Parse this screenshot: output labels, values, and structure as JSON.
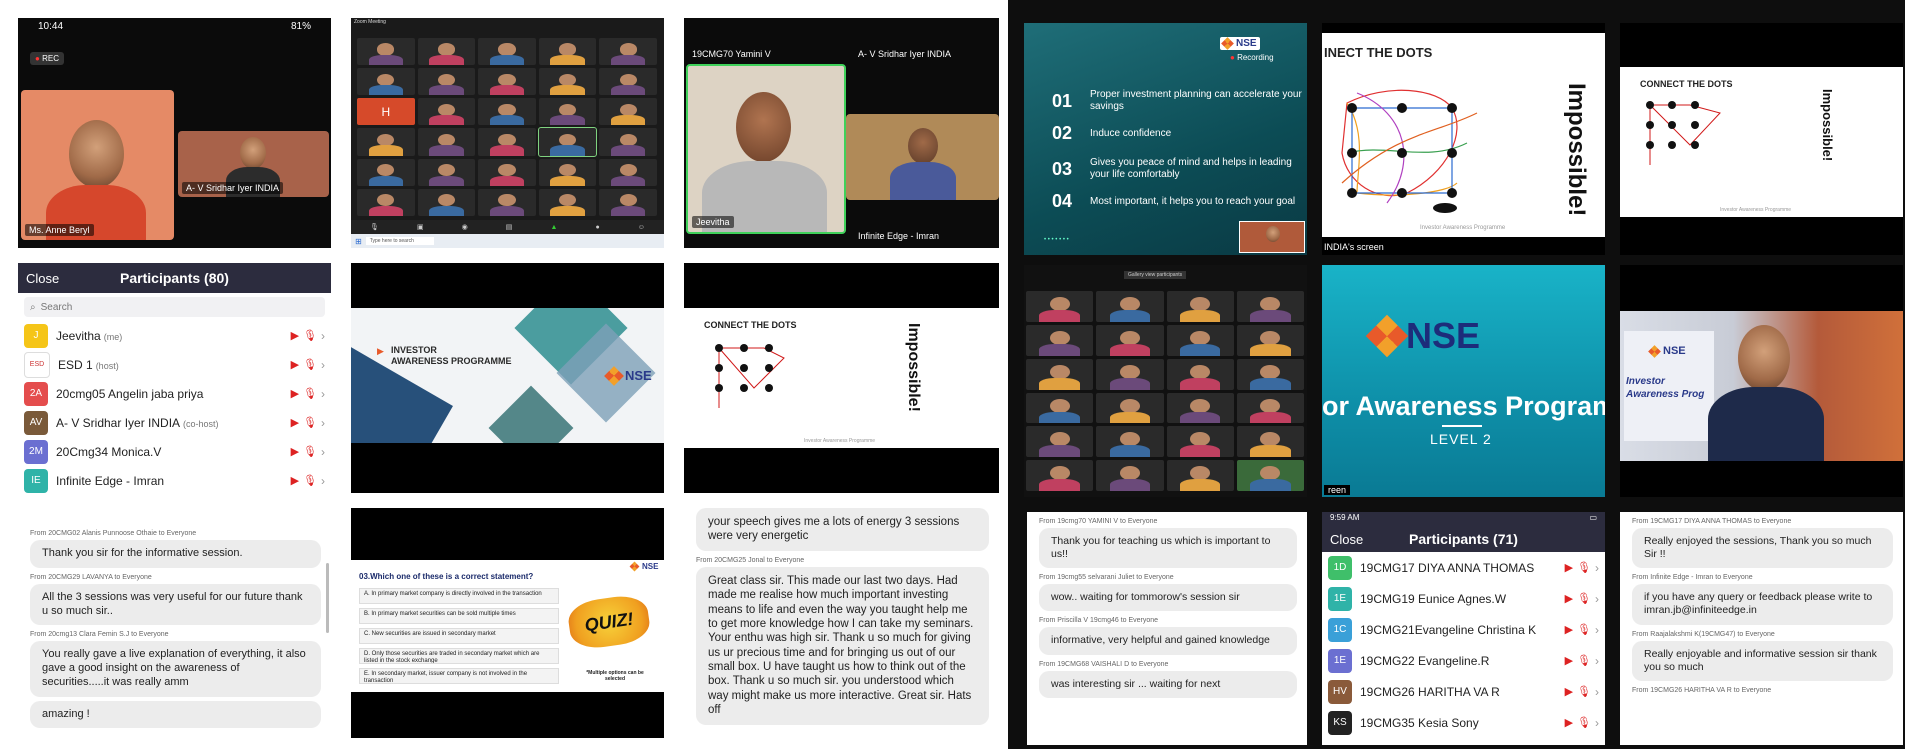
{
  "tile_call": {
    "status_time": "10:44",
    "status_battery": "81%",
    "rec_label": "REC",
    "host_name": "Ms. Anne Beryl",
    "remote_name": "A- V Sridhar Iyer INDIA"
  },
  "tile_zoom_grid": {
    "window_title": "Zoom Meeting",
    "search_placeholder": "Type here to search",
    "h_initial": "H"
  },
  "tile_two": {
    "left_name": "19CMG70 Yamini V",
    "right_name": "A- V Sridhar Iyer INDIA",
    "left_caption": "Jeevitha",
    "right_caption": "Infinite Edge - Imran"
  },
  "participants_left": {
    "close": "Close",
    "title": "Participants (80)",
    "search": "Search",
    "rows": [
      {
        "initials": "J",
        "name": "Jeevitha",
        "tag": "(me)",
        "color": "#f5c518"
      },
      {
        "initials": "ESD",
        "name": "ESD 1",
        "tag": "(host)",
        "color": "#ffffff"
      },
      {
        "initials": "2A",
        "name": "20cmg05 Angelin jaba priya",
        "tag": "",
        "color": "#e44d4d"
      },
      {
        "initials": "AV",
        "name": "A- V Sridhar Iyer INDIA",
        "tag": "(co-host)",
        "color": "#7a5a3a"
      },
      {
        "initials": "2M",
        "name": "20Cmg34 Monica.V",
        "tag": "",
        "color": "#6b6fd1"
      },
      {
        "initials": "IE",
        "name": "Infinite Edge - Imran",
        "tag": "",
        "color": "#2fb3a8"
      }
    ]
  },
  "slide_iap": {
    "title_line1": "INVESTOR",
    "title_line2": "AWARENESS PROGRAMME",
    "logo": "NSE"
  },
  "slide_dots_left": {
    "title": "CONNECT THE DOTS",
    "impossible": "Impossible!",
    "footer": "Investor Awareness Programme"
  },
  "chat_left": {
    "messages": [
      {
        "from": "From 20CMG02 Alanis Punnoose Othaie to Everyone",
        "text": "Thank you sir for the informative session."
      },
      {
        "from": "From 20CMG29 LAVANYA to Everyone",
        "text": "All the 3 sessions was very useful for our future thank u so much sir.."
      },
      {
        "from": "From 20cmg13 Clara Femin S.J to Everyone",
        "text": "You really gave a live explanation of everything, it also gave a good insight on the awareness of securities.....it was really amm"
      },
      {
        "from": "",
        "text": "amazing !"
      }
    ]
  },
  "quiz": {
    "question": "03.Which one of these is a correct statement?",
    "logo": "NSE",
    "badge": "QUIZ!",
    "note": "*Multiple options can be selected",
    "options": [
      "A. In primary market company is directly involved in the transaction",
      "B. In primary market securities can be sold multiple times",
      "C. New securities are issued in secondary market",
      "D. Only those securities are traded in secondary market which are listed in the stock exchange",
      "E. In secondary market, issuer company is not involved in the transaction"
    ]
  },
  "chat_mid": {
    "messages": [
      {
        "from": "",
        "text": "your speech gives me a lots of energy  3 sessions were very energetic"
      },
      {
        "from": "From 20CMG25 Jonal to Everyone",
        "text": "Great class sir. This made our last two days. Had made me realise how much important investing means to life and even the way you taught help me to get more knowledge how I can take my seminars. Your enthu was high sir. Thank u so much for giving us ur precious time and for bringing us out of our small box. U have taught us how to think out of the box. Thank u so much sir. you understood which way might make us more interactive. Great sir. Hats off"
      }
    ]
  },
  "slide_points": {
    "logo": "NSE",
    "recording": "Recording",
    "items": [
      {
        "num": "01",
        "text": "Proper investment planning can accelerate your savings"
      },
      {
        "num": "02",
        "text": "Induce confidence"
      },
      {
        "num": "03",
        "text": "Gives you peace of mind and helps in leading your life comfortably"
      },
      {
        "num": "04",
        "text": "Most important, it helps you to reach your goal"
      }
    ]
  },
  "slide_dots_drawn": {
    "title": "INECT THE DOTS",
    "impossible": "Impossible!",
    "footer": "Investor Awareness Programme",
    "caption": "INDIA's screen"
  },
  "slide_dots_right": {
    "title": "CONNECT THE DOTS",
    "impossible": "Impossible!",
    "footer": "Investor Awareness Programme"
  },
  "tile_gallery_right": {
    "label": "Gallery view participants"
  },
  "slide_nse_level": {
    "logo": "NSE",
    "title": "or Awareness Program",
    "level": "LEVEL 2",
    "caption": "reen"
  },
  "tile_speaker": {
    "logo": "NSE",
    "banner": "Investor Awareness Prog"
  },
  "chat_right1": {
    "messages": [
      {
        "from": "From 19cmg70 YAMINI V to Everyone",
        "text": "Thank you for teaching us which is important to us!!"
      },
      {
        "from": "From 19cmg55 selvarani Juliet to Everyone",
        "text": "wow.. waiting for tommorow's session sir"
      },
      {
        "from": "From Priscilla V 19cmg46 to Everyone",
        "text": "informative, very helpful and gained knowledge"
      },
      {
        "from": "From 19CMG68 VAISHALI D to Everyone",
        "text": "was interesting sir ... waiting for next"
      }
    ]
  },
  "participants_right": {
    "time": "9:59 AM",
    "close": "Close",
    "title": "Participants (71)",
    "rows": [
      {
        "initials": "1D",
        "name": "19CMG17 DIYA ANNA THOMAS",
        "color": "#3fbf6a"
      },
      {
        "initials": "1E",
        "name": "19CMG19 Eunice Agnes.W",
        "color": "#2fb3a8"
      },
      {
        "initials": "1C",
        "name": "19CMG21Evangeline Christina K",
        "color": "#3aa0d8"
      },
      {
        "initials": "1E",
        "name": "19CMG22 Evangeline.R",
        "color": "#6b6fd1"
      },
      {
        "initials": "HV",
        "name": "19CMG26 HARITHA VA R",
        "color": "#8a5a3a"
      },
      {
        "initials": "KS",
        "name": "19CMG35 Kesia Sony",
        "color": "#222222"
      }
    ]
  },
  "chat_right2": {
    "messages": [
      {
        "from": "From 19CMG17 DIYA ANNA THOMAS to Everyone",
        "text": "Really enjoyed the sessions, Thank you so much Sir !!"
      },
      {
        "from": "From Infinite Edge - Imran to Everyone",
        "text": "if you have any query or feedback please write to imran.jb@infiniteedge.in"
      },
      {
        "from": "From Raajalakshmi K(19CMG47) to Everyone",
        "text": "Really enjoyable and informative session sir thank you so much"
      },
      {
        "from": "From 19CMG26 HARITHA VA R to Everyone",
        "text": ""
      }
    ]
  }
}
